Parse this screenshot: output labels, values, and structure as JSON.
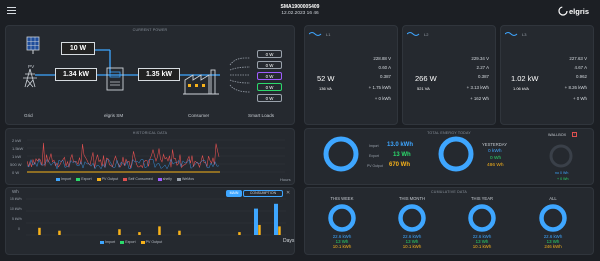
{
  "header": {
    "device_id": "SMA1900005409",
    "datetime": "12.02.2023 16 46",
    "brand": "elgris"
  },
  "current_power": {
    "title": "CURRENT POWER",
    "pv_label": "PV",
    "pv_value": "10 W",
    "grid_label": "Grid",
    "grid_value": "1.34 kW",
    "sm_label": "elgris SM",
    "consumer_value": "1.35 kW",
    "consumer_label": "Consumer",
    "smart_loads_label": "Smart Loads",
    "loads": [
      "0 W",
      "0 W",
      "0 W",
      "0 W",
      "0 W"
    ]
  },
  "phases": [
    {
      "name": "L1",
      "main": "52 W",
      "va": "136 VA",
      "v": "228.88 V",
      "a": "0.60 A",
      "pf": "0.387",
      "plus": "+ 1.75 kWh",
      "minus": "+ 0 kWh"
    },
    {
      "name": "L2",
      "main": "266 W",
      "va": "521 VA",
      "v": "229.34 V",
      "a": "2.27 A",
      "pf": "0.387",
      "plus": "+ 3.13 kWh",
      "minus": "+ 162 Wh"
    },
    {
      "name": "L3",
      "main": "1.02 kW",
      "va": "1.06 kVA",
      "v": "227.63 V",
      "a": "4.67 A",
      "pf": "0.962",
      "plus": "+ 8.26 kWh",
      "minus": "+ 0 Wh"
    }
  ],
  "historical": {
    "title": "HISTORICAL DATA",
    "y_ticks": [
      "2 kW",
      "1.5kW",
      "1 kW",
      "500 W",
      "0 W"
    ],
    "x_label": "Hours",
    "legend": [
      "Import",
      "Export",
      "PV Output",
      "Self Consumed",
      "shelly",
      "WeMos"
    ]
  },
  "total_energy": {
    "title": "TOTAL ENERGY TODAY",
    "import_label": "Import",
    "import_value": "13.0 kWh",
    "export_label": "Export",
    "export_value": "13 Wh",
    "pv_label": "PV Output",
    "pv_value": "670 Wh",
    "yesterday_label": "YESTERDAY",
    "y_import": "0 kWh",
    "y_export": "0 Wh",
    "y_pv": "486 Wh",
    "wallbox_label": "WALLBOX",
    "wb_line1": "no 0 Wh",
    "wb_line2": "+ 0 Wh"
  },
  "bar_chart": {
    "y_unit": "Wh",
    "y_ticks": [
      "15 kWh",
      "10 kWh",
      "5 kWh",
      "0"
    ],
    "x_label": "Days",
    "tab_main": "MAIN",
    "tab_consumption": "CONSUMPTION",
    "legend": [
      "Import",
      "Export",
      "PV Output"
    ]
  },
  "chart_data": {
    "type": "bar",
    "x_label": "Days",
    "legend": [
      "Import",
      "Export",
      "PV Output"
    ],
    "series": [
      {
        "name": "Import",
        "values": [
          0,
          0,
          0,
          0,
          0,
          0,
          0,
          0,
          0,
          0,
          0,
          11,
          13
        ]
      },
      {
        "name": "PV Output",
        "values": [
          0.5,
          0.3,
          0,
          0,
          0.4,
          0.2,
          0.6,
          0.3,
          0,
          0,
          0.2,
          0.7,
          0.6
        ]
      }
    ]
  },
  "cumulative": {
    "title": "CUMULATIVE DATA",
    "periods": [
      {
        "name": "THIS WEEK",
        "import": "22.6 kWh",
        "export": "13 Wh",
        "pv": "10.1 kWh"
      },
      {
        "name": "THIS MONTH",
        "import": "22.6 kWh",
        "export": "13 Wh",
        "pv": "10.1 kWh"
      },
      {
        "name": "THIS YEAR",
        "import": "22.6 kWh",
        "export": "13 Wh",
        "pv": "10.1 kWh"
      },
      {
        "name": "ALL",
        "import": "22.6 kWh",
        "export": "13 Wh",
        "pv": "246 kWh"
      }
    ]
  }
}
